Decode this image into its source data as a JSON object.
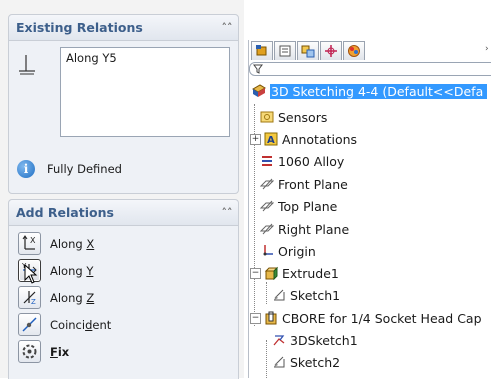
{
  "existing_relations": {
    "title": "Existing Relations",
    "items": [
      "Along Y5"
    ],
    "status": "Fully Defined"
  },
  "add_relations": {
    "title": "Add Relations",
    "options": [
      {
        "label_pre": "Along ",
        "key": "X",
        "label_post": ""
      },
      {
        "label_pre": "Along ",
        "key": "Y",
        "label_post": ""
      },
      {
        "label_pre": "Along ",
        "key": "Z",
        "label_post": ""
      },
      {
        "label_pre": "Coinci",
        "key": "d",
        "label_post": "ent"
      },
      {
        "label_pre": "",
        "key": "F",
        "label_post": "ix"
      }
    ]
  },
  "feature_tree": {
    "root": "3D Sketching 4-4  (Default<<Defa",
    "items": [
      {
        "label": "Sensors",
        "icon": "sensors-icon"
      },
      {
        "label": "Annotations",
        "icon": "annotations-icon"
      },
      {
        "label": "1060 Alloy",
        "icon": "material-icon"
      },
      {
        "label": "Front Plane",
        "icon": "plane-icon"
      },
      {
        "label": "Top Plane",
        "icon": "plane-icon"
      },
      {
        "label": "Right Plane",
        "icon": "plane-icon"
      },
      {
        "label": "Origin",
        "icon": "origin-icon"
      },
      {
        "label": "Extrude1",
        "icon": "extrude-icon"
      },
      {
        "label": "Sketch1",
        "icon": "sketch-icon"
      },
      {
        "label": "CBORE for 1/4 Socket Head Cap",
        "icon": "hole-icon"
      },
      {
        "label": "3DSketch1",
        "icon": "3dsketch-icon"
      },
      {
        "label": "Sketch2",
        "icon": "sketch-icon"
      }
    ]
  },
  "colors": {
    "selection": "#3399ff",
    "group_title": "#3d5f8b"
  }
}
